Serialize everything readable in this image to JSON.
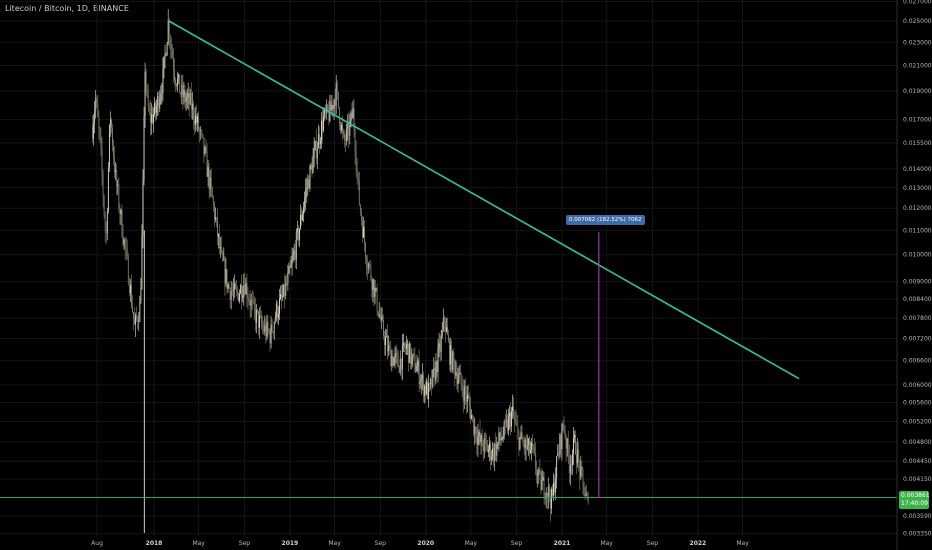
{
  "header": {
    "title": "Litecoin / Bitcoin, 1D, BINANCE"
  },
  "chart_data": {
    "type": "candlestick-line",
    "title": "Litecoin / Bitcoin, 1D, BINANCE",
    "x_labels": [
      "Aug",
      "2018",
      "May",
      "Sep",
      "2019",
      "May",
      "Sep",
      "2020",
      "May",
      "Sep",
      "2021",
      "May",
      "Sep",
      "2022",
      "May"
    ],
    "y_ticks": [
      "0.027000",
      "0.025000",
      "0.023000",
      "0.021000",
      "0.019000",
      "0.017000",
      "0.015500",
      "0.014000",
      "0.013000",
      "0.012000",
      "0.011000",
      "0.010000",
      "0.009000",
      "0.008400",
      "0.007800",
      "0.007200",
      "0.006600",
      "0.006000",
      "0.005600",
      "0.005200",
      "0.004800",
      "0.004450",
      "0.004150",
      "0.003590",
      "0.003350"
    ],
    "y_scale": "log",
    "price_path": [
      [
        "2017-07-20",
        0.0165
      ],
      [
        "2017-07-28",
        0.0185
      ],
      [
        "2017-08-10",
        0.0152
      ],
      [
        "2017-08-25",
        0.0105
      ],
      [
        "2017-09-05",
        0.0175
      ],
      [
        "2017-09-20",
        0.0135
      ],
      [
        "2017-10-10",
        0.0108
      ],
      [
        "2017-10-25",
        0.0092
      ],
      [
        "2017-11-10",
        0.0075
      ],
      [
        "2017-11-25",
        0.0082
      ],
      [
        "2017-12-01",
        0.0115
      ],
      [
        "2017-12-08",
        0.021
      ],
      [
        "2017-12-12",
        0.0185
      ],
      [
        "2017-12-20",
        0.017
      ],
      [
        "2018-01-05",
        0.0175
      ],
      [
        "2018-01-25",
        0.02
      ],
      [
        "2018-02-08",
        0.0248
      ],
      [
        "2018-02-25",
        0.0205
      ],
      [
        "2018-03-15",
        0.0188
      ],
      [
        "2018-04-10",
        0.018
      ],
      [
        "2018-04-30",
        0.0165
      ],
      [
        "2018-05-20",
        0.0145
      ],
      [
        "2018-06-10",
        0.012
      ],
      [
        "2018-07-01",
        0.0098
      ],
      [
        "2018-07-20",
        0.0088
      ],
      [
        "2018-08-10",
        0.0085
      ],
      [
        "2018-09-01",
        0.009
      ],
      [
        "2018-09-25",
        0.008
      ],
      [
        "2018-10-20",
        0.0075
      ],
      [
        "2018-11-10",
        0.0073
      ],
      [
        "2018-11-25",
        0.008
      ],
      [
        "2018-12-15",
        0.0085
      ],
      [
        "2019-01-05",
        0.0095
      ],
      [
        "2019-01-25",
        0.011
      ],
      [
        "2019-02-15",
        0.013
      ],
      [
        "2019-03-10",
        0.015
      ],
      [
        "2019-04-01",
        0.017
      ],
      [
        "2019-04-20",
        0.0175
      ],
      [
        "2019-05-05",
        0.019
      ],
      [
        "2019-05-25",
        0.0155
      ],
      [
        "2019-06-05",
        0.016
      ],
      [
        "2019-06-20",
        0.0175
      ],
      [
        "2019-07-05",
        0.0125
      ],
      [
        "2019-07-25",
        0.01
      ],
      [
        "2019-08-15",
        0.0088
      ],
      [
        "2019-09-05",
        0.0075
      ],
      [
        "2019-09-25",
        0.0068
      ],
      [
        "2019-10-20",
        0.0065
      ],
      [
        "2019-11-10",
        0.007
      ],
      [
        "2019-11-25",
        0.0066
      ],
      [
        "2019-12-10",
        0.0064
      ],
      [
        "2019-12-25",
        0.006
      ],
      [
        "2020-01-10",
        0.0058
      ],
      [
        "2020-01-25",
        0.0063
      ],
      [
        "2020-02-10",
        0.007
      ],
      [
        "2020-02-20",
        0.0078
      ],
      [
        "2020-03-05",
        0.0068
      ],
      [
        "2020-03-20",
        0.0064
      ],
      [
        "2020-04-05",
        0.006
      ],
      [
        "2020-04-25",
        0.0056
      ],
      [
        "2020-05-10",
        0.0051
      ],
      [
        "2020-05-25",
        0.0048
      ],
      [
        "2020-06-10",
        0.0047
      ],
      [
        "2020-06-30",
        0.0046
      ],
      [
        "2020-07-15",
        0.0048
      ],
      [
        "2020-08-01",
        0.005
      ],
      [
        "2020-08-20",
        0.0054
      ],
      [
        "2020-09-05",
        0.0049
      ],
      [
        "2020-09-25",
        0.0047
      ],
      [
        "2020-10-15",
        0.0046
      ],
      [
        "2020-11-01",
        0.0041
      ],
      [
        "2020-11-20",
        0.004
      ],
      [
        "2020-12-05",
        0.0038
      ],
      [
        "2020-12-20",
        0.0045
      ],
      [
        "2021-01-05",
        0.0052
      ],
      [
        "2021-01-20",
        0.0044
      ],
      [
        "2021-02-05",
        0.0048
      ],
      [
        "2021-02-20",
        0.0042
      ],
      [
        "2021-03-05",
        0.0039
      ],
      [
        "2021-03-15",
        0.0036
      ]
    ],
    "trendline": {
      "from": [
        "2018-02-10",
        0.025
      ],
      "to": [
        "2022-09-30",
        0.00615
      ]
    },
    "horizontal_line": {
      "value": 0.00386
    },
    "measure": {
      "date": "2021-04-10",
      "from": 0.00386,
      "to": 0.01092,
      "label": "0.007062 (182.52%) 7062"
    },
    "last_price": {
      "value": "0.003861",
      "countdown": "17:40:09"
    }
  }
}
